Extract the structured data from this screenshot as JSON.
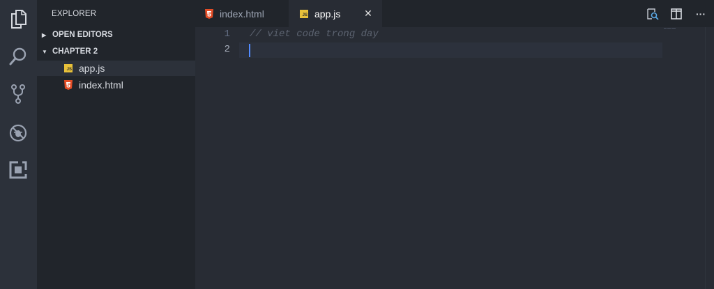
{
  "activity_bar": {
    "icons": [
      "files-icon",
      "search-icon",
      "source-control-icon",
      "debug-icon",
      "extensions-icon"
    ]
  },
  "sidebar": {
    "title": "EXPLORER",
    "open_editors_label": "OPEN EDITORS",
    "folder_label": "CHAPTER 2",
    "files": [
      {
        "name": "app.js",
        "icon": "js-file-icon",
        "active": true
      },
      {
        "name": "index.html",
        "icon": "html-file-icon",
        "active": false
      }
    ]
  },
  "tabs": [
    {
      "label": "index.html",
      "icon": "html-file-icon",
      "active": false
    },
    {
      "label": "app.js",
      "icon": "js-file-icon",
      "active": true
    }
  ],
  "tab_close_glyph": "✕",
  "js_badge_text": "JS",
  "toolbar": {
    "icons": [
      "open-changes-icon",
      "split-editor-icon",
      "more-actions-icon"
    ],
    "more_glyph": "···"
  },
  "editor": {
    "line_numbers": [
      "1",
      "2"
    ],
    "lines": [
      "// viet code trong day",
      ""
    ],
    "current_line": 2
  },
  "colors": {
    "activity_bar_bg": "#2c313a",
    "sidebar_bg": "#21252b",
    "editor_bg": "#282c34",
    "html_icon": "#e44d26",
    "js_icon": "#e8c13a",
    "cursor": "#528bff",
    "comment": "#5c6370"
  }
}
